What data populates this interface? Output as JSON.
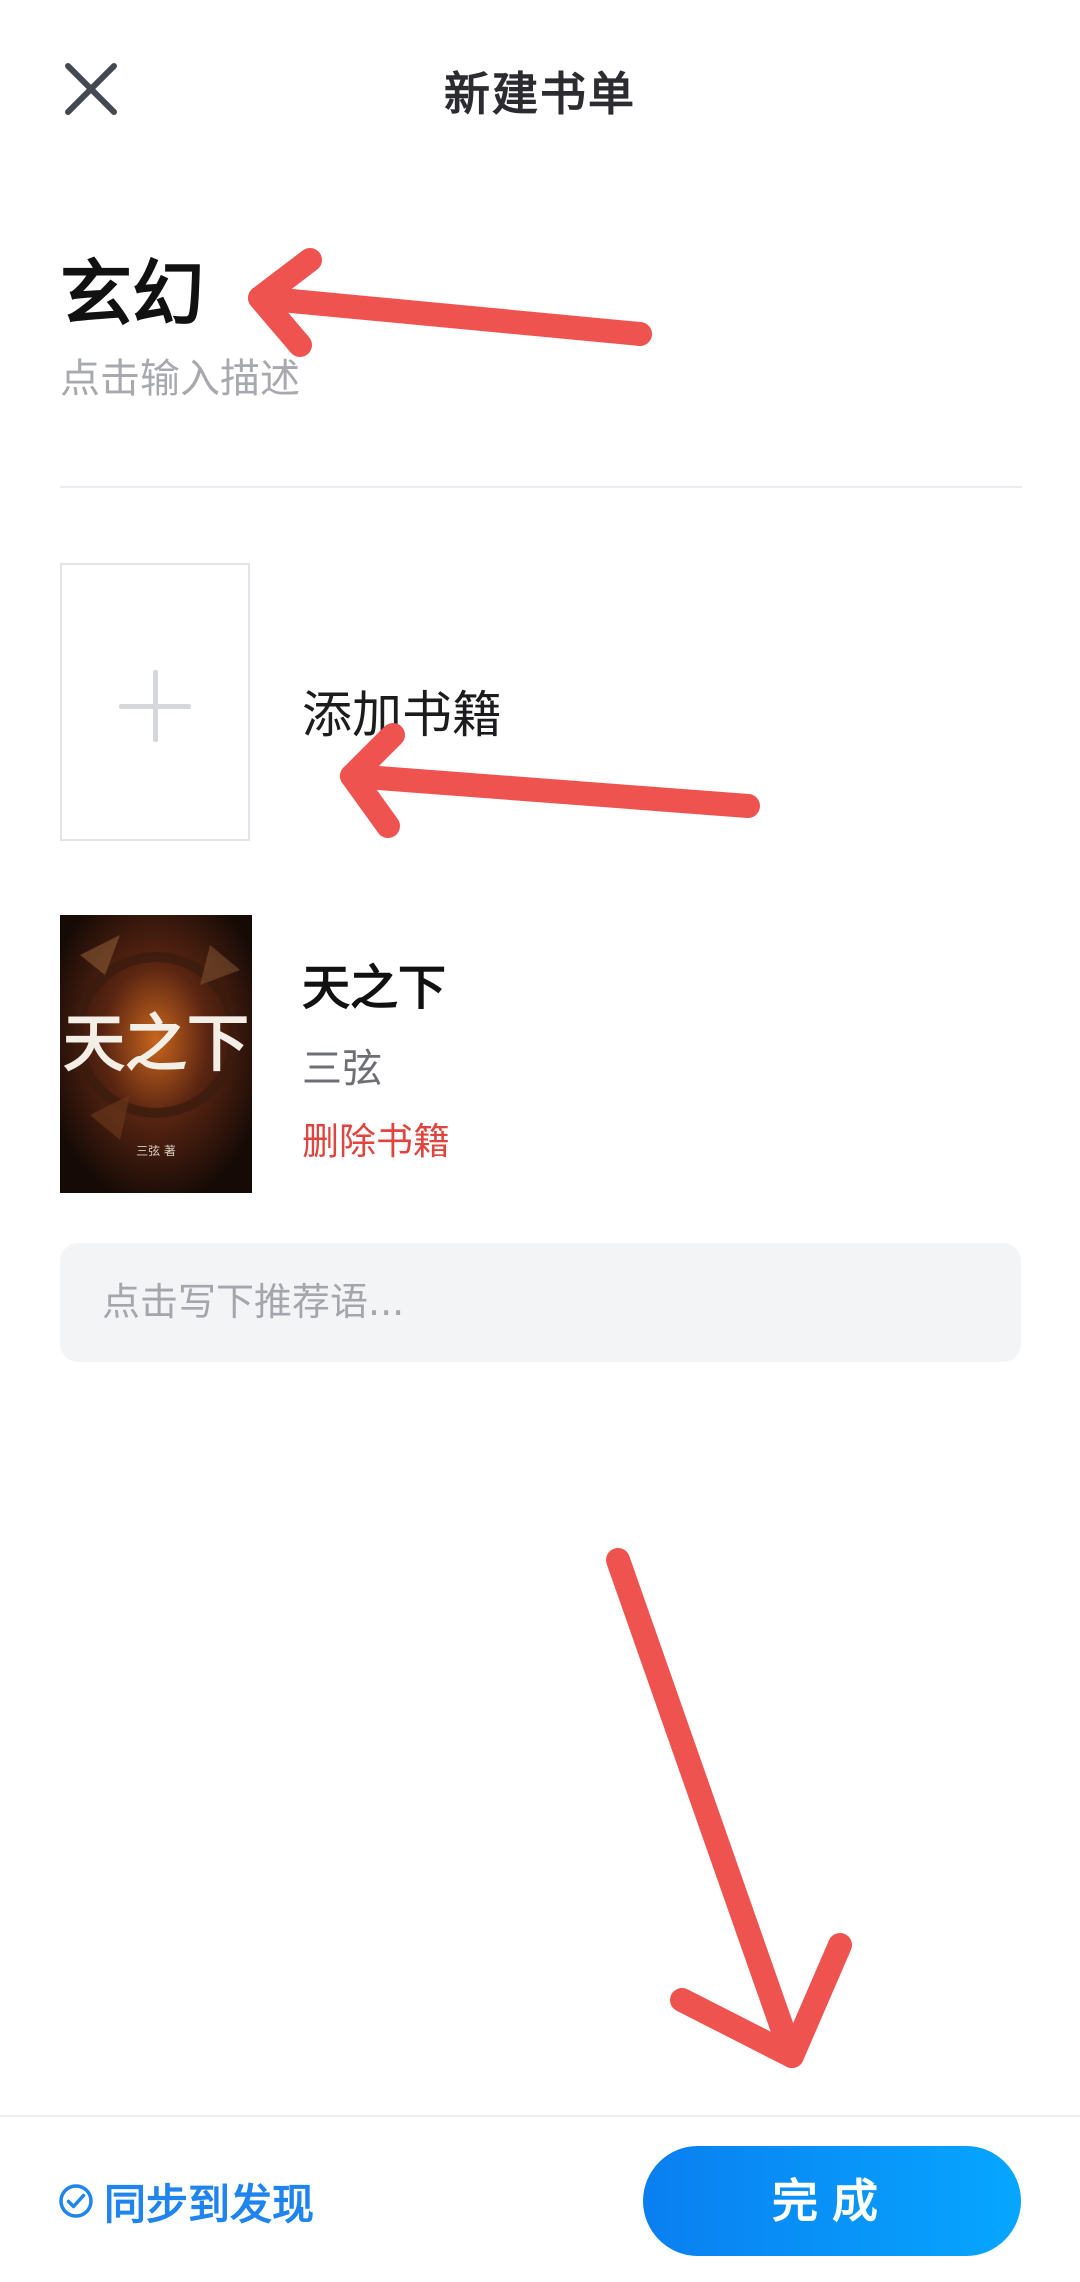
{
  "header": {
    "title": "新建书单",
    "close_icon": "close-icon"
  },
  "booklist": {
    "name": "玄幻",
    "description_placeholder": "点击输入描述"
  },
  "add_book": {
    "label": "添加书籍",
    "icon": "plus-icon"
  },
  "book": {
    "title": "天之下",
    "author": "三弦",
    "delete_label": "删除书籍",
    "cover_title": "天之下",
    "cover_author": "三弦 著"
  },
  "recommendation": {
    "placeholder": "点击写下推荐语..."
  },
  "bottom": {
    "sync_label": "同步到发现",
    "sync_icon": "check-circle-icon",
    "done_label": "完成"
  },
  "colors": {
    "accent": "#1f84ee",
    "delete": "#e0443e",
    "annotation_arrow": "#ef5350"
  }
}
